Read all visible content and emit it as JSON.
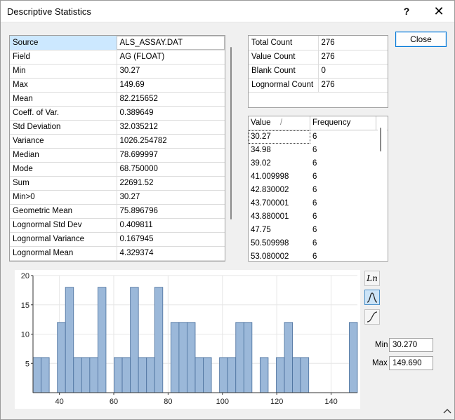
{
  "window": {
    "title": "Descriptive Statistics",
    "help_label": "?",
    "close_glyph": "✕"
  },
  "stats": [
    {
      "key": "Source",
      "value": "ALS_ASSAY.DAT"
    },
    {
      "key": "Field",
      "value": "AG (FLOAT)"
    },
    {
      "key": "Min",
      "value": "30.27"
    },
    {
      "key": "Max",
      "value": "149.69"
    },
    {
      "key": "Mean",
      "value": "82.215652"
    },
    {
      "key": "Coeff. of Var.",
      "value": "0.389649"
    },
    {
      "key": "Std Deviation",
      "value": "32.035212"
    },
    {
      "key": "Variance",
      "value": "1026.254782"
    },
    {
      "key": "Median",
      "value": "78.699997"
    },
    {
      "key": "Mode",
      "value": "68.750000"
    },
    {
      "key": "Sum",
      "value": "22691.52"
    },
    {
      "key": "Min>0",
      "value": "30.27"
    },
    {
      "key": "Geometric Mean",
      "value": "75.896796"
    },
    {
      "key": "Lognormal Std Dev",
      "value": "0.409811"
    },
    {
      "key": "Lognormal Variance",
      "value": "0.167945"
    },
    {
      "key": "Lognormal Mean",
      "value": "4.329374"
    }
  ],
  "counts": [
    {
      "key": "Total Count",
      "value": "276"
    },
    {
      "key": "Value Count",
      "value": "276"
    },
    {
      "key": "Blank Count",
      "value": "0"
    },
    {
      "key": "Lognormal Count",
      "value": "276"
    }
  ],
  "frequency": {
    "header_value": "Value",
    "header_sort_glyph": "/",
    "header_frequency": "Frequency",
    "rows": [
      {
        "value": "30.27",
        "freq": "6"
      },
      {
        "value": "34.98",
        "freq": "6"
      },
      {
        "value": "39.02",
        "freq": "6"
      },
      {
        "value": "41.009998",
        "freq": "6"
      },
      {
        "value": "42.830002",
        "freq": "6"
      },
      {
        "value": "43.700001",
        "freq": "6"
      },
      {
        "value": "43.880001",
        "freq": "6"
      },
      {
        "value": "47.75",
        "freq": "6"
      },
      {
        "value": "50.509998",
        "freq": "6"
      },
      {
        "value": "53.080002",
        "freq": "6"
      }
    ]
  },
  "buttons": {
    "close": "Close",
    "ln": "Ln"
  },
  "range": {
    "min_label": "Min",
    "min_value": "30.270",
    "max_label": "Max",
    "max_value": "149.690"
  },
  "colors": {
    "bar_fill": "#9bb8d9",
    "bar_stroke": "#4a6f9c",
    "selection": "#cce8ff",
    "accent": "#0078d7"
  },
  "chart_data": {
    "type": "bar",
    "title": "",
    "xlabel": "",
    "ylabel": "",
    "xlim": [
      30.27,
      149.69
    ],
    "ylim": [
      0,
      20
    ],
    "x_ticks": [
      40,
      60,
      80,
      100,
      120,
      140
    ],
    "y_ticks": [
      5,
      10,
      15,
      20
    ],
    "grid": true,
    "bin_width": 2.99,
    "bin_starts": [
      30.27,
      33.26,
      36.24,
      39.23,
      42.21,
      45.2,
      48.18,
      51.17,
      54.15,
      57.14,
      60.12,
      63.11,
      66.1,
      69.08,
      72.07,
      75.05,
      78.04,
      81.02,
      84.01,
      86.99,
      89.98,
      92.96,
      95.95,
      98.93,
      101.92,
      104.91,
      107.89,
      110.88,
      113.86,
      116.85,
      119.83,
      122.82,
      125.8,
      128.79,
      131.77,
      134.76,
      137.74,
      140.73,
      143.71,
      146.7
    ],
    "values": [
      6,
      6,
      0,
      12,
      18,
      6,
      6,
      6,
      18,
      0,
      6,
      6,
      18,
      6,
      6,
      18,
      0,
      12,
      12,
      12,
      6,
      6,
      0,
      6,
      6,
      12,
      12,
      0,
      6,
      0,
      6,
      12,
      6,
      6,
      0,
      0,
      0,
      0,
      0,
      12
    ]
  }
}
